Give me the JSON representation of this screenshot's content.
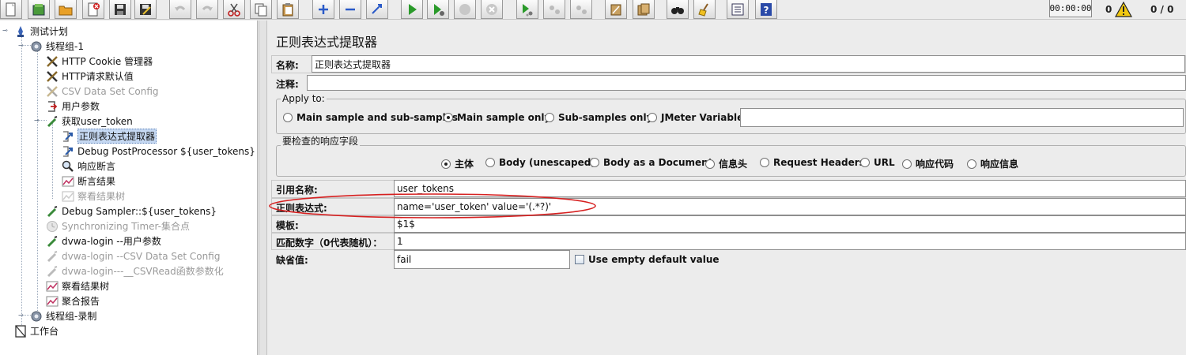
{
  "toolbar": {
    "buttons": [
      {
        "icon": "new-file-icon"
      },
      {
        "icon": "templates-icon"
      },
      {
        "icon": "open-folder-icon"
      },
      {
        "icon": "close-icon"
      },
      {
        "icon": "save-icon"
      },
      {
        "icon": "save-as-icon"
      },
      {
        "icon": "undo-icon"
      },
      {
        "icon": "redo-icon"
      },
      {
        "icon": "cut-icon"
      },
      {
        "icon": "copy-icon"
      },
      {
        "icon": "paste-icon"
      },
      {
        "icon": "expand-icon"
      },
      {
        "icon": "collapse-icon"
      },
      {
        "icon": "toggle-icon"
      },
      {
        "icon": "start-icon"
      },
      {
        "icon": "start-no-pauses-icon"
      },
      {
        "icon": "stop-icon"
      },
      {
        "icon": "shutdown-icon"
      },
      {
        "icon": "remote-start-icon"
      },
      {
        "icon": "remote-stop-icon"
      },
      {
        "icon": "remote-shutdown-icon"
      },
      {
        "icon": "clear-icon"
      },
      {
        "icon": "clear-all-icon"
      },
      {
        "icon": "search-binoculars-icon"
      },
      {
        "icon": "reset-search-broom-icon"
      },
      {
        "icon": "function-helper-icon"
      },
      {
        "icon": "help-icon"
      }
    ],
    "timer": "00:00:00",
    "warning_count": "0",
    "thread_count": "0 / 0"
  },
  "tree": {
    "nodes": [
      {
        "label": "测试计划",
        "icon": "test-plan-icon"
      },
      {
        "label": "线程组-1",
        "icon": "thread-group-gear-icon"
      },
      {
        "label": "HTTP Cookie 管理器",
        "icon": "config-tools-icon"
      },
      {
        "label": "HTTP请求默认值",
        "icon": "config-tools-icon"
      },
      {
        "label": "CSV Data Set Config",
        "icon": "config-tools-icon"
      },
      {
        "label": "用户参数",
        "icon": "preprocessor-icon"
      },
      {
        "label": "获取user_token",
        "icon": "sampler-pipette-icon"
      },
      {
        "label": "正则表达式提取器",
        "icon": "postprocessor-icon"
      },
      {
        "label": "Debug PostProcessor  ${user_tokens}",
        "icon": "postprocessor-icon"
      },
      {
        "label": "响应断言",
        "icon": "assertion-magnifier-icon"
      },
      {
        "label": "断言结果",
        "icon": "listener-graph-icon"
      },
      {
        "label": "察看结果树",
        "icon": "listener-graph-icon"
      },
      {
        "label": "Debug Sampler::${user_tokens}",
        "icon": "sampler-pipette-icon"
      },
      {
        "label": "Synchronizing Timer-集合点",
        "icon": "timer-icon"
      },
      {
        "label": "dvwa-login --用户参数",
        "icon": "sampler-pipette-icon"
      },
      {
        "label": "dvwa-login --CSV Data Set Config",
        "icon": "sampler-pipette-icon"
      },
      {
        "label": "dvwa-login---__CSVRead函数参数化",
        "icon": "sampler-pipette-icon"
      },
      {
        "label": "察看结果树",
        "icon": "listener-graph-icon"
      },
      {
        "label": "聚合报告",
        "icon": "listener-graph-icon"
      },
      {
        "label": "线程组-录制",
        "icon": "thread-group-gear-icon"
      },
      {
        "label": "工作台",
        "icon": "workbench-icon"
      }
    ]
  },
  "panel": {
    "title": "正则表达式提取器",
    "name_label": "名称:",
    "name_value": "正则表达式提取器",
    "comment_label": "注释:",
    "comment_value": "",
    "apply_to": {
      "title": "Apply to:",
      "options": [
        "Main sample and sub-samples",
        "Main sample only",
        "Sub-samples only",
        "JMeter Variable"
      ],
      "selected": "Main sample only",
      "variable_value": ""
    },
    "field_to_check": {
      "title": "要检查的响应字段",
      "options": [
        "主体",
        "Body (unescaped)",
        "Body as a Document",
        "信息头",
        "Request Headers",
        "URL",
        "响应代码",
        "响应信息"
      ],
      "selected": "主体"
    },
    "ref_name_label": "引用名称:",
    "ref_name_value": "user_tokens",
    "regex_label": "正则表达式:",
    "regex_value": "name='user_token' value='(.*?)'",
    "template_label": "模板:",
    "template_value": "$1$",
    "match_no_label": "匹配数字（0代表随机）：",
    "match_no_value": "1",
    "default_label": "缺省值:",
    "default_value": "fail",
    "use_empty_label": "Use empty default value",
    "use_empty_checked": false
  },
  "colors": {
    "selection_bg": "#c5d8f2",
    "annotation_ellipse": "#d62020",
    "disabled_text": "#9a9a9a"
  }
}
